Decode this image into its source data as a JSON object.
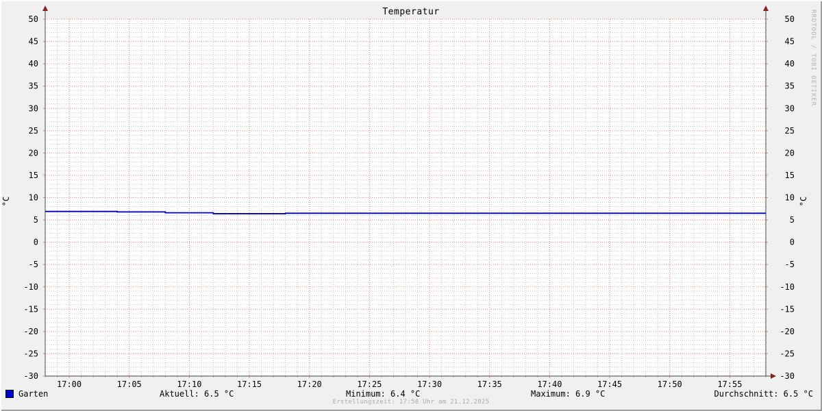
{
  "title": "Temperatur",
  "y_unit": "°C",
  "watermark": "RRDTOOL / TOBI OETIKER",
  "footer": "Erstellungszeit: 17:58 Uhr am 21.12.2025",
  "legend": {
    "series_label": "Garten",
    "swatch_color": "#0000cc",
    "aktuell": "Aktuell: 6.5 °C",
    "minimum": "Minimum: 6.4 °C",
    "maximum": "Maximum: 6.9 °C",
    "durchschnitt": "Durchschnitt: 6.5 °C"
  },
  "colors": {
    "background": "#f0f0f0",
    "canvas": "#ffffff",
    "major_grid": "#e87c7c",
    "minor_grid": "#c8c8c8",
    "axis": "#666666",
    "arrow": "#8b2323",
    "line": "#0000b4"
  },
  "chart_data": {
    "type": "line",
    "title": "Temperatur",
    "xlabel": "",
    "ylabel": "°C",
    "ylim": [
      -30,
      50
    ],
    "y_major_step": 5,
    "y_minor_step": 1,
    "x_start": "16:58",
    "x_end": "17:58",
    "x_major_step_minutes": 5,
    "x_minor_step_minutes": 1,
    "x_tick_labels": [
      "17:00",
      "17:05",
      "17:10",
      "17:15",
      "17:20",
      "17:25",
      "17:30",
      "17:35",
      "17:40",
      "17:45",
      "17:50",
      "17:55"
    ],
    "grid": "on",
    "legend_position": "bottom",
    "series": [
      {
        "name": "Garten",
        "color": "#0000b4",
        "step": true,
        "points": [
          [
            "16:58",
            6.9
          ],
          [
            "17:04",
            6.8
          ],
          [
            "17:08",
            6.6
          ],
          [
            "17:12",
            6.4
          ],
          [
            "17:18",
            6.5
          ],
          [
            "17:58",
            6.5
          ]
        ]
      }
    ],
    "stats": {
      "aktuell": 6.5,
      "minimum": 6.4,
      "maximum": 6.9,
      "durchschnitt": 6.5
    }
  }
}
